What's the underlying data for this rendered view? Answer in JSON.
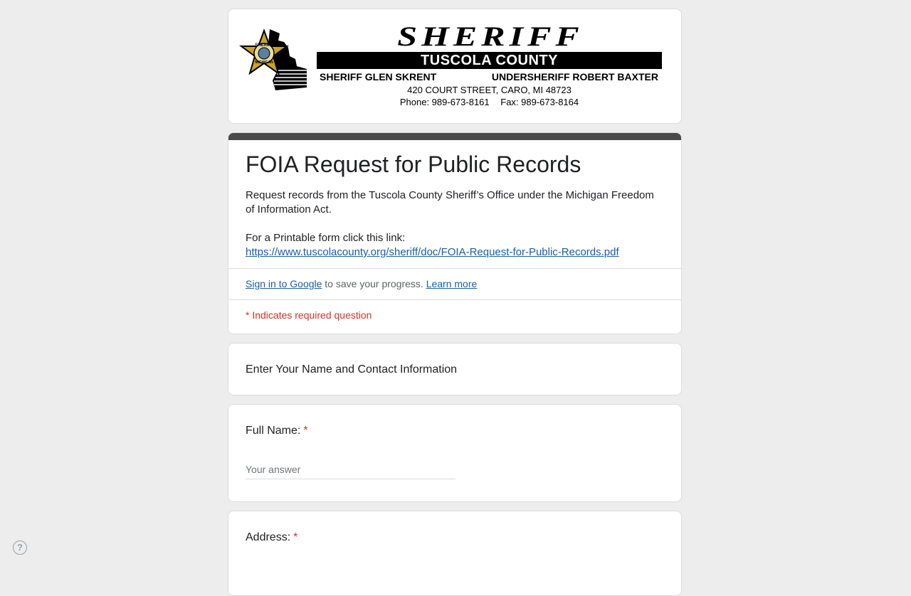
{
  "banner": {
    "heading": "SHERIFF",
    "county": "TUSCOLA COUNTY",
    "badge_text": "SHERIFF",
    "badge_state": "MICHIGAN",
    "sheriff": "SHERIFF GLEN SKRENT",
    "undersheriff": "UNDERSHERIFF ROBERT BAXTER",
    "address": "420 COURT STREET, CARO, MI 48723",
    "phone": "Phone: 989-673-8161",
    "fax": "Fax: 989-673-8164"
  },
  "form": {
    "title": "FOIA Request for Public Records",
    "description": "Request records from the Tuscola County Sheriff’s Office under the Michigan Freedom of Information Act.",
    "printable_label": "For a Printable form click this link:",
    "printable_link": "https://www.tuscolacounty.org/sheriff/doc/FOIA-Request-for-Public-Records.pdf",
    "signin_link": "Sign in to Google",
    "signin_text": " to save your progress. ",
    "learn_more": "Learn more",
    "required_note": "* Indicates required question"
  },
  "section": {
    "title": "Enter Your Name and Contact Information"
  },
  "questions": [
    {
      "label": "Full Name:",
      "required_mark": "*",
      "placeholder": "Your answer"
    },
    {
      "label": "Address:",
      "required_mark": "*"
    }
  ],
  "help": {
    "icon": "question-mark-icon",
    "glyph": "?"
  },
  "colors": {
    "page_background": "#ededed",
    "header_bar": "#4a4a4a",
    "link": "#1a5fa8",
    "required": "#d93025"
  }
}
